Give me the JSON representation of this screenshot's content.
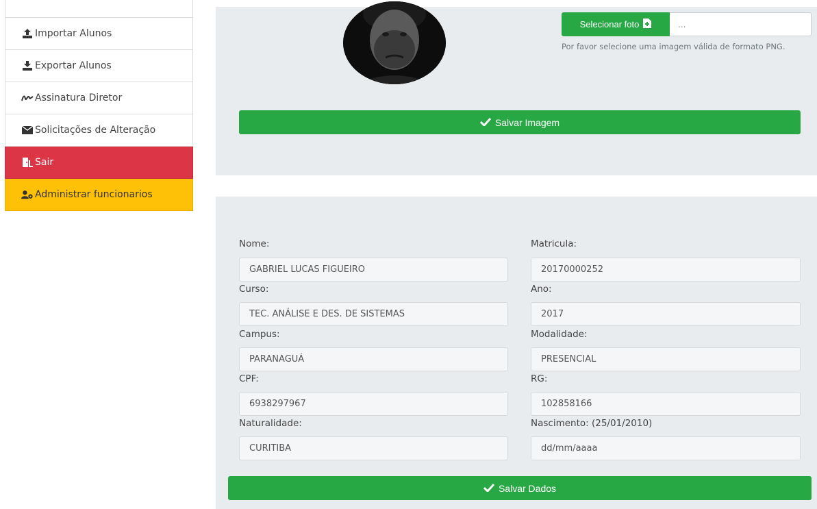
{
  "sidebar": {
    "items": [
      {
        "label": "Importar Alunos",
        "icon": "upload-icon"
      },
      {
        "label": "Exportar Alunos",
        "icon": "download-icon"
      },
      {
        "label": "Assinatura Diretor",
        "icon": "signature-icon"
      },
      {
        "label": "Solicitações de Alteração",
        "icon": "envelope-icon"
      },
      {
        "label": "Sair",
        "icon": "door-exit-icon"
      },
      {
        "label": "Administrar funcionarios",
        "icon": "users-cog-icon"
      }
    ]
  },
  "photo": {
    "select_label": "Selecionar foto",
    "file_placeholder": "...",
    "hint": "Por favor selecione uma imagem válida de formato PNG.",
    "save_label": "Salvar Imagem"
  },
  "form": {
    "nome_label": "Nome:",
    "nome_value": "GABRIEL LUCAS FIGUEIRO",
    "matricula_label": "Matricula:",
    "matricula_value": "20170000252",
    "curso_label": "Curso:",
    "curso_value": "TEC. ANÁLISE E DES. DE SISTEMAS",
    "ano_label": "Ano:",
    "ano_value": "2017",
    "campus_label": "Campus:",
    "campus_value": "PARANAGUÁ",
    "modalidade_label": "Modalidade:",
    "modalidade_value": "PRESENCIAL",
    "cpf_label": "CPF:",
    "cpf_value": "6938297967",
    "rg_label": "RG:",
    "rg_value": "102858166",
    "naturalidade_label": "Naturalidade:",
    "naturalidade_value": "CURITIBA",
    "nascimento_label": "Nascimento: (25/01/2010)",
    "nascimento_placeholder": "dd/mm/aaaa",
    "save_label": "Salvar Dados"
  },
  "colors": {
    "success": "#28a745",
    "danger": "#dc3545",
    "warning": "#ffc107",
    "panel_bg": "#e9ecef"
  }
}
